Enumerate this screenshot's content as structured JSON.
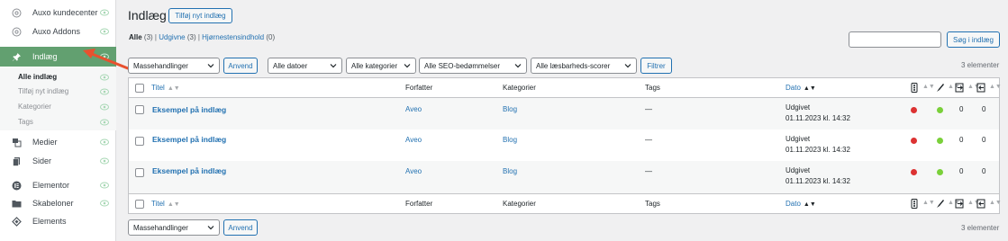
{
  "sidebar": {
    "items": [
      {
        "label": "Auxo kundecenter",
        "icon": "auxo-icon"
      },
      {
        "label": "Auxo Addons",
        "icon": "auxo-icon"
      },
      {
        "label": "Indlæg",
        "icon": "pin-icon",
        "active": true
      },
      {
        "label": "Medier",
        "icon": "media-icon"
      },
      {
        "label": "Sider",
        "icon": "pages-icon"
      },
      {
        "label": "Elementor",
        "icon": "elementor-icon"
      },
      {
        "label": "Skabeloner",
        "icon": "folder-icon"
      },
      {
        "label": "Elements",
        "icon": "elements-icon"
      }
    ],
    "submenu": [
      "Alle indlæg",
      "Tilføj nyt indlæg",
      "Kategorier",
      "Tags"
    ]
  },
  "header": {
    "title": "Indlæg",
    "add_new_label": "Tilføj nyt indlæg"
  },
  "filters_links": {
    "all": "Alle",
    "all_count": "(3)",
    "published": "Udgivne",
    "published_count": "(3)",
    "cornerstone": "Hjørnestensindhold",
    "cornerstone_count": "(0)",
    "sep": "|"
  },
  "search": {
    "button_label": "Søg i indlæg",
    "value": ""
  },
  "tablenav": {
    "bulk_actions": "Massehandlinger",
    "apply_label": "Anvend",
    "all_dates": "Alle datoer",
    "all_categories": "Alle kategorier",
    "all_seo": "Alle SEO-bedømmelser",
    "all_readability": "Alle læsbarheds-scorer",
    "filter_label": "Filtrer",
    "items_count": "3 elementer"
  },
  "table": {
    "columns": {
      "title": "Titel",
      "author": "Forfatter",
      "categories": "Kategorier",
      "tags": "Tags",
      "date": "Dato"
    },
    "rows": [
      {
        "title": "Eksempel på indlæg",
        "author": "Aveo",
        "category": "Blog",
        "tags": "—",
        "status": "Udgivet",
        "date": "01.11.2023 kl. 14:32",
        "links_out": "0",
        "links_in": "0"
      },
      {
        "title": "Eksempel på indlæg",
        "author": "Aveo",
        "category": "Blog",
        "tags": "—",
        "status": "Udgivet",
        "date": "01.11.2023 kl. 14:32",
        "links_out": "0",
        "links_in": "0"
      },
      {
        "title": "Eksempel på indlæg",
        "author": "Aveo",
        "category": "Blog",
        "tags": "—",
        "status": "Udgivet",
        "date": "01.11.2023 kl. 14:32",
        "links_out": "0",
        "links_in": "0"
      }
    ]
  },
  "colors": {
    "accent": "#2271b1",
    "active_menu": "#62a070",
    "seo_red": "#dc3232",
    "readability_green": "#7ad03a",
    "annotation_arrow": "#e8512f"
  }
}
